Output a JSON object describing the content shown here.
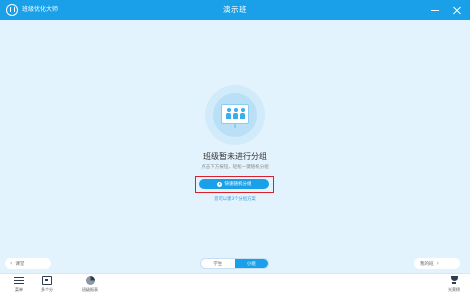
{
  "titlebar": {
    "brand_name": "班级优化大师",
    "title": "演示班",
    "bg_color": "#1aa0e8"
  },
  "main": {
    "illustration": "group-illustration-icon",
    "title": "班级暂未进行分组",
    "subtitle": "点击下方按钮，轻松一键随机分组",
    "cta_label": "快速随机分组",
    "hint": "您可以建3个分组方案",
    "bg_color": "#e3f3fd",
    "highlight_color": "#d9202b"
  },
  "nav": {
    "prev_label": "课堂",
    "next_label": "我的班"
  },
  "view_toggle": {
    "options": [
      "学生",
      "小组"
    ],
    "selected": "小组"
  },
  "toolbar": {
    "items": [
      {
        "icon": "menu-icon",
        "label": "菜单"
      },
      {
        "icon": "board-icon",
        "label": "多个分"
      },
      {
        "icon": "pie-chart-icon",
        "label": "班级报表"
      },
      {
        "icon": "trophy-icon",
        "label": "光荣榜"
      }
    ]
  }
}
